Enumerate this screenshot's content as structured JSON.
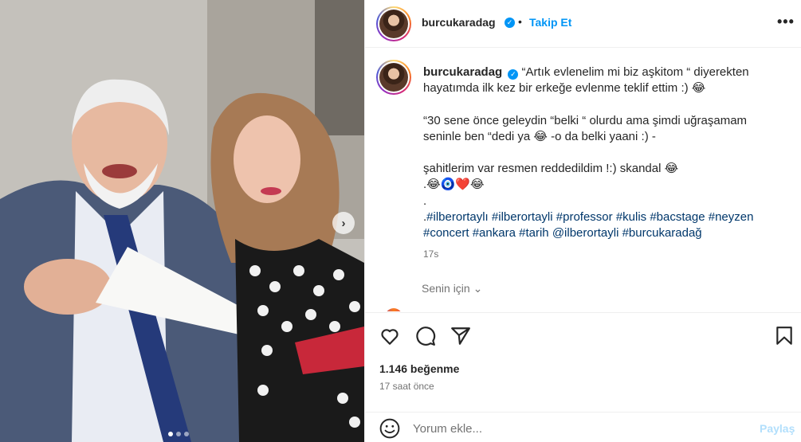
{
  "post": {
    "author": "burcukaradag",
    "verified_mark": "✓",
    "separator": "•",
    "follow_label": "Takip Et",
    "more_label": "•••",
    "caption_lines": [
      "“Artık evlenelim mi biz aşkitom “ diyerekten",
      "hayatımda ilk kez bir erkeğe evlenme teklif ettim :) 😂",
      "“30 sene önce geleydin “belki “ olurdu ama şimdi uğraşamam",
      "seninle ben “dedi ya 😂 -o da belki yaani :) -",
      "şahitlerim var resmen reddedildim !:) skandal 😂",
      ".😂🧿❤️😂",
      "."
    ],
    "hashtag_prefix": ".",
    "hashtags": [
      "#ilberortaylı",
      "#ilberortayli",
      "#professor",
      "#kulis",
      "#bacstage",
      "#neyzen",
      "#concert",
      "#ankara",
      "#tarih",
      "@ilberortayli",
      "#burcukaradağ"
    ],
    "caption_time": "17s",
    "for_you_label": "Senin için",
    "chevron": "⌄",
    "likes": "1.146 beğenme",
    "posted_ago": "17 saat önce",
    "comment_placeholder": "Yorum ekle...",
    "post_label": "Paylaş"
  },
  "carousel": {
    "next_label": "›",
    "slides_total": 3,
    "active_slide": 1
  },
  "icons": {
    "like": "heart-icon",
    "comment": "comment-icon",
    "share": "paper-plane-icon",
    "save": "bookmark-icon",
    "emoji": "smiley-icon"
  },
  "colors": {
    "link_blue": "#0095f6",
    "hashtag": "#00376b",
    "muted": "#737373",
    "border": "#efefef"
  }
}
